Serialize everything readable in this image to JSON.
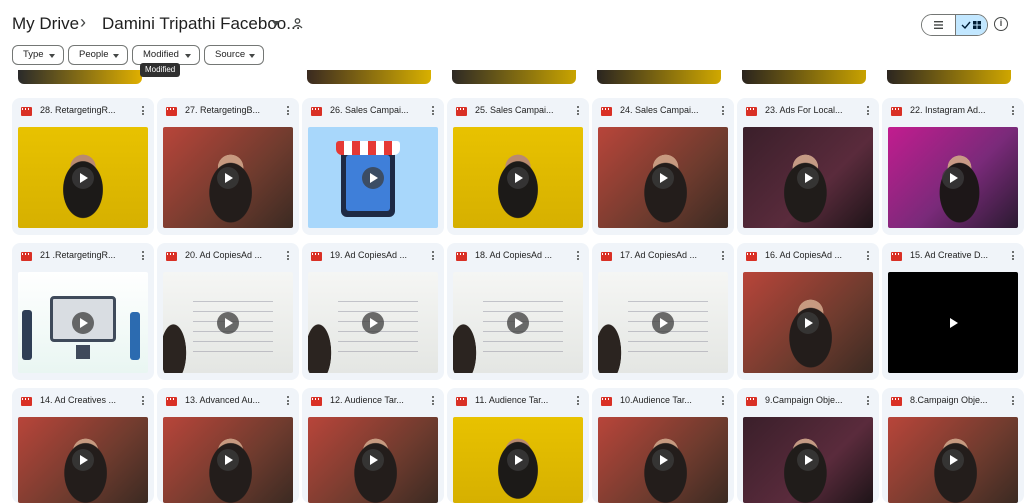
{
  "header": {
    "root": "My Drive",
    "separator": "›",
    "folder": "Damini Tripathi Faceboo...",
    "icons": {
      "caret": "caret-down-icon",
      "shared": "shared-folder-icon",
      "list": "list-view-icon",
      "grid": "grid-view-icon",
      "info": "info-icon"
    }
  },
  "filters": [
    {
      "label": "Type"
    },
    {
      "label": "People"
    },
    {
      "label": "Modified"
    },
    {
      "label": "Source"
    }
  ],
  "tooltip": "Modified",
  "cards": [
    {
      "title": "28. RetargetingR...",
      "thumb": "yellow",
      "play": "round"
    },
    {
      "title": "27. RetargetingB...",
      "thumb": "red",
      "play": "round"
    },
    {
      "title": "26. Sales Campai...",
      "thumb": "shop",
      "play": "round"
    },
    {
      "title": "25. Sales Campai...",
      "thumb": "yellow",
      "play": "round"
    },
    {
      "title": "24. Sales Campai...",
      "thumb": "red",
      "play": "round"
    },
    {
      "title": "23. Ads For Local...",
      "thumb": "studio",
      "play": "round"
    },
    {
      "title": "22. Instagram Ad...",
      "thumb": "pink",
      "play": "round"
    },
    {
      "title": "21 .RetargetingR...",
      "thumb": "illustration",
      "play": "round"
    },
    {
      "title": "20. Ad CopiesAd ...",
      "thumb": "whiteboard",
      "play": "round"
    },
    {
      "title": "19. Ad CopiesAd ...",
      "thumb": "whiteboard",
      "play": "round"
    },
    {
      "title": "18. Ad CopiesAd ...",
      "thumb": "whiteboard",
      "play": "round"
    },
    {
      "title": "17. Ad CopiesAd ...",
      "thumb": "whiteboard",
      "play": "round"
    },
    {
      "title": "16. Ad CopiesAd ...",
      "thumb": "red",
      "play": "round"
    },
    {
      "title": "15. Ad Creative D...",
      "thumb": "black",
      "play": "plain"
    },
    {
      "title": "14. Ad Creatives ...",
      "thumb": "red",
      "play": "round"
    },
    {
      "title": "13. Advanced Au...",
      "thumb": "red",
      "play": "round"
    },
    {
      "title": "12. Audience Tar...",
      "thumb": "red",
      "play": "round"
    },
    {
      "title": "11. Audience Tar...",
      "thumb": "yellow",
      "play": "round"
    },
    {
      "title": "10.Audience Tar...",
      "thumb": "red",
      "play": "round"
    },
    {
      "title": "9.Campaign Obje...",
      "thumb": "studio",
      "play": "round"
    },
    {
      "title": "8.Campaign Obje...",
      "thumb": "red",
      "play": "round"
    }
  ],
  "colors": {
    "grid_active": "#c2e7ff",
    "card_bg": "#f0f4f9",
    "file_icon": "#d93025"
  }
}
